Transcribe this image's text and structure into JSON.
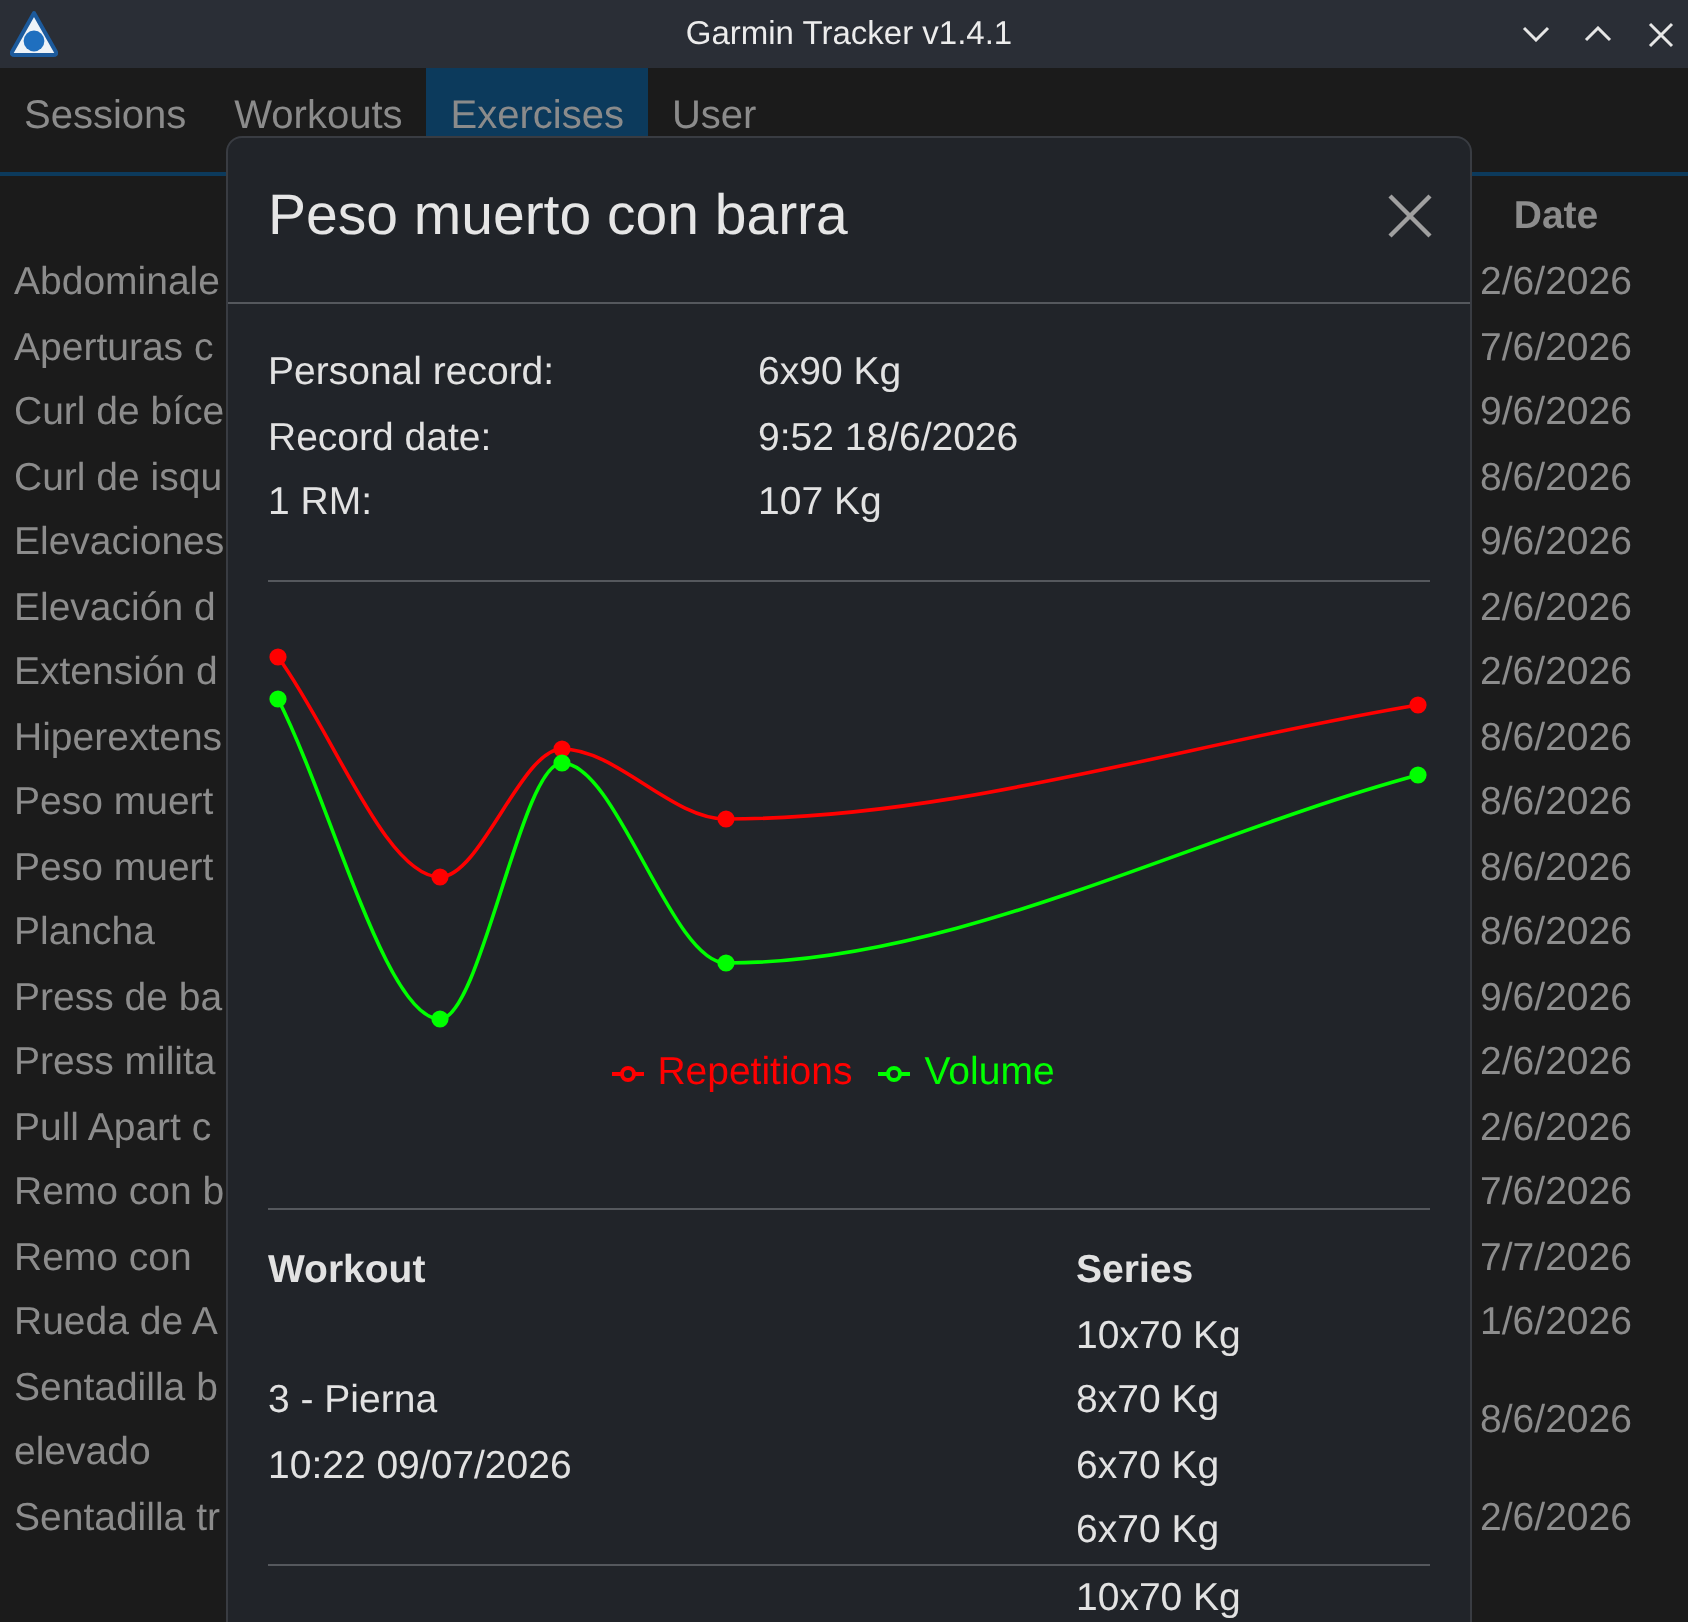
{
  "window": {
    "title": "Garmin Tracker v1.4.1"
  },
  "tabs": [
    {
      "label": "Sessions",
      "selected": false
    },
    {
      "label": "Workouts",
      "selected": false
    },
    {
      "label": "Exercises",
      "selected": true
    },
    {
      "label": "User",
      "selected": false
    }
  ],
  "exercise_list": {
    "date_header": "Date",
    "rows": [
      {
        "name_lines": [
          "Abdominale"
        ],
        "date": "2/6/2026"
      },
      {
        "name_lines": [
          "Aperturas c"
        ],
        "date": "7/6/2026"
      },
      {
        "name_lines": [
          "Curl de bíce"
        ],
        "date": "9/6/2026"
      },
      {
        "name_lines": [
          "Curl de isqu"
        ],
        "date": "8/6/2026"
      },
      {
        "name_lines": [
          "Elevaciones"
        ],
        "date": "9/6/2026"
      },
      {
        "name_lines": [
          "Elevación d"
        ],
        "date": "2/6/2026"
      },
      {
        "name_lines": [
          "Extensión d"
        ],
        "date": "2/6/2026"
      },
      {
        "name_lines": [
          "Hiperextens"
        ],
        "date": "8/6/2026"
      },
      {
        "name_lines": [
          "Peso muert"
        ],
        "date": "8/6/2026"
      },
      {
        "name_lines": [
          "Peso muert"
        ],
        "date": "8/6/2026"
      },
      {
        "name_lines": [
          "Plancha"
        ],
        "date": "8/6/2026"
      },
      {
        "name_lines": [
          "Press de ba"
        ],
        "date": "9/6/2026"
      },
      {
        "name_lines": [
          "Press milita"
        ],
        "date": "2/6/2026"
      },
      {
        "name_lines": [
          "Pull Apart c"
        ],
        "date": "2/6/2026"
      },
      {
        "name_lines": [
          "Remo con b"
        ],
        "date": "7/6/2026"
      },
      {
        "name_lines": [
          "Remo con"
        ],
        "date": "7/7/2026"
      },
      {
        "name_lines": [
          "Rueda de A"
        ],
        "date": "1/6/2026"
      },
      {
        "name_lines": [
          "Sentadilla b",
          "elevado"
        ],
        "date": "8/6/2026"
      },
      {
        "name_lines": [
          "Sentadilla tr"
        ],
        "date": "2/6/2026"
      }
    ]
  },
  "exercise_dialog": {
    "title": "Peso muerto con barra",
    "stats": [
      {
        "label": "Personal record:",
        "value": "6x90 Kg"
      },
      {
        "label": "Record date:",
        "value": "9:52 18/6/2026"
      },
      {
        "label": "1 RM:",
        "value": "107 Kg"
      }
    ],
    "chart": {
      "legend": [
        {
          "label": "Repetitions",
          "color": "#ff0000"
        },
        {
          "label": "Volume",
          "color": "#00ff00"
        }
      ]
    },
    "history": {
      "columns": [
        "Workout",
        "Series"
      ],
      "rows": [
        {
          "workout": "3 - Pierna",
          "date": "10:22 09/07/2026",
          "series": [
            "10x70 Kg",
            "8x70 Kg",
            "6x70 Kg",
            "6x70 Kg"
          ]
        },
        {
          "series": [
            "10x70 Kg"
          ]
        }
      ]
    }
  }
}
